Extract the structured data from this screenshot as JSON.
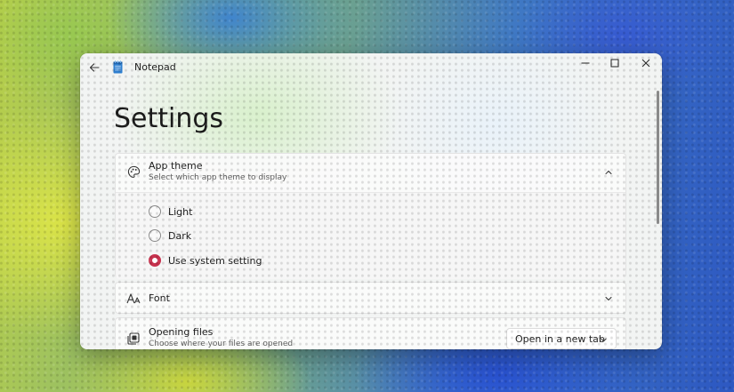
{
  "window": {
    "app_title": "Notepad",
    "app_icon": "notepad-icon",
    "back_icon": "back-arrow-icon",
    "caption_icons": [
      "minimize-icon",
      "maximize-icon",
      "close-icon"
    ]
  },
  "page": {
    "title": "Settings"
  },
  "app_theme": {
    "icon": "palette-icon",
    "title": "App theme",
    "subtitle": "Select which app theme to display",
    "expanded": true,
    "options": [
      {
        "label": "Light",
        "selected": false
      },
      {
        "label": "Dark",
        "selected": false
      },
      {
        "label": "Use system setting",
        "selected": true
      }
    ]
  },
  "font": {
    "icon": "font-size-icon",
    "title": "Font"
  },
  "opening_files": {
    "icon": "open-files-icon",
    "title": "Opening files",
    "subtitle": "Choose where your files are opened",
    "dropdown_value": "Open in a new tab"
  },
  "colors": {
    "accent": "#c8324e"
  }
}
